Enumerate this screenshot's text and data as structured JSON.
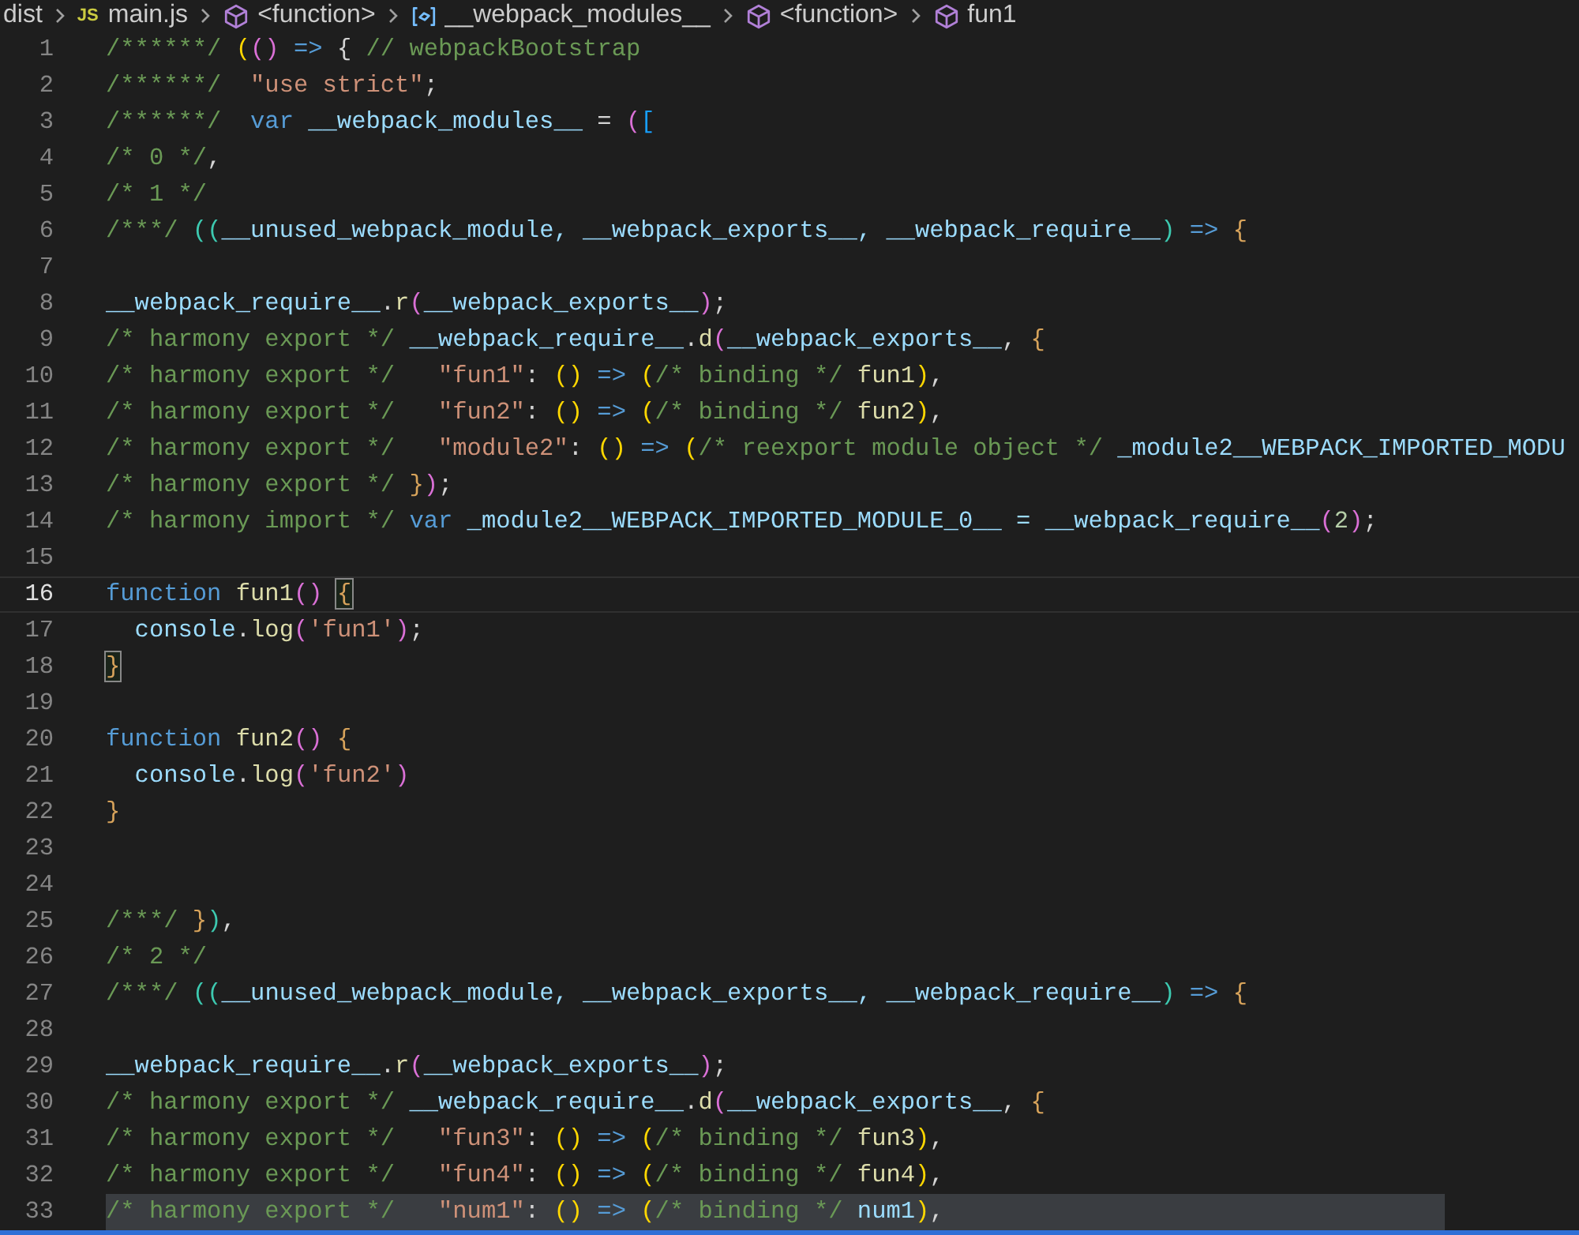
{
  "breadcrumb": [
    {
      "label": "dist",
      "kind": "folder"
    },
    {
      "label": "main.js",
      "kind": "file",
      "icon_text": "JS"
    },
    {
      "label": "<function>",
      "kind": "function"
    },
    {
      "label": "__webpack_modules__",
      "kind": "variable"
    },
    {
      "label": "<function>",
      "kind": "function"
    },
    {
      "label": "fun1",
      "kind": "function"
    }
  ],
  "lines": [
    {
      "number": "1",
      "current": false,
      "highlighted": false,
      "tokens": [
        {
          "t": "/******/ ",
          "kind": "comment"
        },
        {
          "t": "(",
          "kind": "yellow"
        },
        {
          "t": "()",
          "kind": "pink"
        },
        {
          "t": " => ",
          "kind": "keyword"
        },
        {
          "t": "{ ",
          "kind": "plain"
        },
        {
          "t": "// webpackBootstrap",
          "kind": "comment"
        }
      ]
    },
    {
      "number": "2",
      "current": false,
      "highlighted": false,
      "tokens": [
        {
          "t": "/******/  ",
          "kind": "comment"
        },
        {
          "t": "\"use strict\"",
          "kind": "string"
        },
        {
          "t": ";",
          "kind": "plain"
        }
      ]
    },
    {
      "number": "3",
      "current": false,
      "highlighted": false,
      "tokens": [
        {
          "t": "/******/  ",
          "kind": "comment"
        },
        {
          "t": "var ",
          "kind": "keyword"
        },
        {
          "t": "__webpack_modules__",
          "kind": "variable"
        },
        {
          "t": " = ",
          "kind": "plain"
        },
        {
          "t": "(",
          "kind": "pink"
        },
        {
          "t": "[",
          "kind": "blue"
        }
      ]
    },
    {
      "number": "4",
      "current": false,
      "highlighted": false,
      "tokens": [
        {
          "t": "/* 0 */",
          "kind": "comment"
        },
        {
          "t": ",",
          "kind": "plain"
        }
      ]
    },
    {
      "number": "5",
      "current": false,
      "highlighted": false,
      "tokens": [
        {
          "t": "/* 1 */",
          "kind": "comment"
        }
      ]
    },
    {
      "number": "6",
      "current": false,
      "highlighted": false,
      "tokens": [
        {
          "t": "/***/ ",
          "kind": "comment"
        },
        {
          "t": "((",
          "kind": "green"
        },
        {
          "t": "__unused_webpack_module, __webpack_exports__, __webpack_require__",
          "kind": "variable"
        },
        {
          "t": ")",
          "kind": "green"
        },
        {
          "t": " => ",
          "kind": "keyword"
        },
        {
          "t": "{",
          "kind": "orange"
        }
      ]
    },
    {
      "number": "7",
      "current": false,
      "highlighted": false
    },
    {
      "number": "8",
      "current": false,
      "highlighted": false,
      "tokens": [
        {
          "t": "__webpack_require__",
          "kind": "variable"
        },
        {
          "t": ".",
          "kind": "plain"
        },
        {
          "t": "r",
          "kind": "function"
        },
        {
          "t": "(",
          "kind": "pink"
        },
        {
          "t": "__webpack_exports__",
          "kind": "variable"
        },
        {
          "t": ")",
          "kind": "pink"
        },
        {
          "t": ";",
          "kind": "plain"
        }
      ]
    },
    {
      "number": "9",
      "current": false,
      "highlighted": false,
      "tokens": [
        {
          "t": "/* harmony export */ ",
          "kind": "comment"
        },
        {
          "t": "__webpack_require__",
          "kind": "variable"
        },
        {
          "t": ".",
          "kind": "plain"
        },
        {
          "t": "d",
          "kind": "function"
        },
        {
          "t": "(",
          "kind": "pink"
        },
        {
          "t": "__webpack_exports__",
          "kind": "variable"
        },
        {
          "t": ", ",
          "kind": "plain"
        },
        {
          "t": "{",
          "kind": "orange"
        }
      ]
    },
    {
      "number": "10",
      "current": false,
      "highlighted": false,
      "tokens": [
        {
          "t": "/* harmony export */   ",
          "kind": "comment"
        },
        {
          "t": "\"fun1\"",
          "kind": "string"
        },
        {
          "t": ": ",
          "kind": "plain"
        },
        {
          "t": "()",
          "kind": "yellow"
        },
        {
          "t": " => ",
          "kind": "keyword"
        },
        {
          "t": "(",
          "kind": "yellow"
        },
        {
          "t": "/* binding */ ",
          "kind": "comment"
        },
        {
          "t": "fun1",
          "kind": "function"
        },
        {
          "t": ")",
          "kind": "yellow"
        },
        {
          "t": ",",
          "kind": "plain"
        }
      ]
    },
    {
      "number": "11",
      "current": false,
      "highlighted": false,
      "tokens": [
        {
          "t": "/* harmony export */   ",
          "kind": "comment"
        },
        {
          "t": "\"fun2\"",
          "kind": "string"
        },
        {
          "t": ": ",
          "kind": "plain"
        },
        {
          "t": "()",
          "kind": "yellow"
        },
        {
          "t": " => ",
          "kind": "keyword"
        },
        {
          "t": "(",
          "kind": "yellow"
        },
        {
          "t": "/* binding */ ",
          "kind": "comment"
        },
        {
          "t": "fun2",
          "kind": "function"
        },
        {
          "t": ")",
          "kind": "yellow"
        },
        {
          "t": ",",
          "kind": "plain"
        }
      ]
    },
    {
      "number": "12",
      "current": false,
      "highlighted": false,
      "tokens": [
        {
          "t": "/* harmony export */   ",
          "kind": "comment"
        },
        {
          "t": "\"module2\"",
          "kind": "string"
        },
        {
          "t": ": ",
          "kind": "plain"
        },
        {
          "t": "()",
          "kind": "yellow"
        },
        {
          "t": " => ",
          "kind": "keyword"
        },
        {
          "t": "(",
          "kind": "yellow"
        },
        {
          "t": "/* reexport module object */ ",
          "kind": "comment"
        },
        {
          "t": "_module2__WEBPACK_IMPORTED_MODU",
          "kind": "variable"
        }
      ]
    },
    {
      "number": "13",
      "current": false,
      "highlighted": false,
      "tokens": [
        {
          "t": "/* harmony export */ ",
          "kind": "comment"
        },
        {
          "t": "}",
          "kind": "orange"
        },
        {
          "t": ")",
          "kind": "pink"
        },
        {
          "t": ";",
          "kind": "plain"
        }
      ]
    },
    {
      "number": "14",
      "current": false,
      "highlighted": false,
      "tokens": [
        {
          "t": "/* harmony import */ ",
          "kind": "comment"
        },
        {
          "t": "var ",
          "kind": "keyword"
        },
        {
          "t": "_module2__WEBPACK_IMPORTED_MODULE_0__ = __webpack_require__",
          "kind": "variable"
        },
        {
          "t": "(",
          "kind": "pink"
        },
        {
          "t": "2",
          "kind": "number"
        },
        {
          "t": ")",
          "kind": "pink"
        },
        {
          "t": ";",
          "kind": "plain"
        }
      ]
    },
    {
      "number": "15",
      "current": false,
      "highlighted": false
    },
    {
      "number": "16",
      "current": true,
      "highlighted": false,
      "tokens": [
        {
          "t": "function ",
          "kind": "keyword"
        },
        {
          "t": "fun1",
          "kind": "function"
        },
        {
          "t": "() ",
          "kind": "pink"
        },
        {
          "t": "{",
          "kind": "orange",
          "matched": true
        }
      ]
    },
    {
      "number": "17",
      "current": false,
      "highlighted": false,
      "tokens": [
        {
          "t": "  console",
          "kind": "variable"
        },
        {
          "t": ".",
          "kind": "plain"
        },
        {
          "t": "log",
          "kind": "function"
        },
        {
          "t": "(",
          "kind": "pink"
        },
        {
          "t": "'fun1'",
          "kind": "string"
        },
        {
          "t": ")",
          "kind": "pink"
        },
        {
          "t": ";",
          "kind": "plain"
        }
      ]
    },
    {
      "number": "18",
      "current": false,
      "highlighted": false,
      "tokens": [
        {
          "t": "}",
          "kind": "orange",
          "matched": true
        }
      ]
    },
    {
      "number": "19",
      "current": false,
      "highlighted": false
    },
    {
      "number": "20",
      "current": false,
      "highlighted": false,
      "tokens": [
        {
          "t": "function ",
          "kind": "keyword"
        },
        {
          "t": "fun2",
          "kind": "function"
        },
        {
          "t": "() ",
          "kind": "pink"
        },
        {
          "t": "{",
          "kind": "orange",
          "matched": false
        }
      ]
    },
    {
      "number": "21",
      "current": false,
      "highlighted": false,
      "tokens": [
        {
          "t": "  console",
          "kind": "variable"
        },
        {
          "t": ".",
          "kind": "plain"
        },
        {
          "t": "log",
          "kind": "function"
        },
        {
          "t": "(",
          "kind": "pink"
        },
        {
          "t": "'fun2'",
          "kind": "string"
        },
        {
          "t": ")",
          "kind": "pink"
        }
      ]
    },
    {
      "number": "22",
      "current": false,
      "highlighted": false,
      "tokens": [
        {
          "t": "}",
          "kind": "orange",
          "matched": false
        }
      ]
    },
    {
      "number": "23",
      "current": false,
      "highlighted": false
    },
    {
      "number": "24",
      "current": false,
      "highlighted": false
    },
    {
      "number": "25",
      "current": false,
      "highlighted": false,
      "tokens": [
        {
          "t": "/***/ ",
          "kind": "comment"
        },
        {
          "t": "}",
          "kind": "orange"
        },
        {
          "t": ")",
          "kind": "green"
        },
        {
          "t": ",",
          "kind": "plain"
        }
      ]
    },
    {
      "number": "26",
      "current": false,
      "highlighted": false,
      "tokens": [
        {
          "t": "/* 2 */",
          "kind": "comment"
        }
      ]
    },
    {
      "number": "27",
      "current": false,
      "highlighted": false,
      "tokens": [
        {
          "t": "/***/ ",
          "kind": "comment"
        },
        {
          "t": "((",
          "kind": "green"
        },
        {
          "t": "__unused_webpack_module, __webpack_exports__, __webpack_require__",
          "kind": "variable"
        },
        {
          "t": ")",
          "kind": "green"
        },
        {
          "t": " => ",
          "kind": "keyword"
        },
        {
          "t": "{",
          "kind": "orange"
        }
      ]
    },
    {
      "number": "28",
      "current": false,
      "highlighted": false
    },
    {
      "number": "29",
      "current": false,
      "highlighted": false,
      "tokens": [
        {
          "t": "__webpack_require__",
          "kind": "variable"
        },
        {
          "t": ".",
          "kind": "plain"
        },
        {
          "t": "r",
          "kind": "function"
        },
        {
          "t": "(",
          "kind": "pink"
        },
        {
          "t": "__webpack_exports__",
          "kind": "variable"
        },
        {
          "t": ")",
          "kind": "pink"
        },
        {
          "t": ";",
          "kind": "plain"
        }
      ]
    },
    {
      "number": "30",
      "current": false,
      "highlighted": false,
      "tokens": [
        {
          "t": "/* harmony export */ ",
          "kind": "comment"
        },
        {
          "t": "__webpack_require__",
          "kind": "variable"
        },
        {
          "t": ".",
          "kind": "plain"
        },
        {
          "t": "d",
          "kind": "function"
        },
        {
          "t": "(",
          "kind": "pink"
        },
        {
          "t": "__webpack_exports__",
          "kind": "variable"
        },
        {
          "t": ", ",
          "kind": "plain"
        },
        {
          "t": "{",
          "kind": "orange"
        }
      ]
    },
    {
      "number": "31",
      "current": false,
      "highlighted": false,
      "tokens": [
        {
          "t": "/* harmony export */   ",
          "kind": "comment"
        },
        {
          "t": "\"fun3\"",
          "kind": "string"
        },
        {
          "t": ": ",
          "kind": "plain"
        },
        {
          "t": "()",
          "kind": "yellow"
        },
        {
          "t": " => ",
          "kind": "keyword"
        },
        {
          "t": "(",
          "kind": "yellow"
        },
        {
          "t": "/* binding */ ",
          "kind": "comment"
        },
        {
          "t": "fun3",
          "kind": "function"
        },
        {
          "t": ")",
          "kind": "yellow"
        },
        {
          "t": ",",
          "kind": "plain"
        }
      ]
    },
    {
      "number": "32",
      "current": false,
      "highlighted": false,
      "tokens": [
        {
          "t": "/* harmony export */   ",
          "kind": "comment"
        },
        {
          "t": "\"fun4\"",
          "kind": "string"
        },
        {
          "t": ": ",
          "kind": "plain"
        },
        {
          "t": "()",
          "kind": "yellow"
        },
        {
          "t": " => ",
          "kind": "keyword"
        },
        {
          "t": "(",
          "kind": "yellow"
        },
        {
          "t": "/* binding */ ",
          "kind": "comment"
        },
        {
          "t": "fun4",
          "kind": "function"
        },
        {
          "t": ")",
          "kind": "yellow"
        },
        {
          "t": ",",
          "kind": "plain"
        }
      ]
    },
    {
      "number": "33",
      "current": false,
      "highlighted": true,
      "tokens": [
        {
          "t": "/* harmony export */   ",
          "kind": "comment"
        },
        {
          "t": "\"num1\"",
          "kind": "string"
        },
        {
          "t": ": ",
          "kind": "plain"
        },
        {
          "t": "()",
          "kind": "yellow"
        },
        {
          "t": " => ",
          "kind": "keyword"
        },
        {
          "t": "(",
          "kind": "yellow"
        },
        {
          "t": "/* binding */ ",
          "kind": "comment"
        },
        {
          "t": "num1",
          "kind": "variable"
        },
        {
          "t": ")",
          "kind": "yellow"
        },
        {
          "t": ",",
          "kind": "plain"
        }
      ]
    }
  ]
}
